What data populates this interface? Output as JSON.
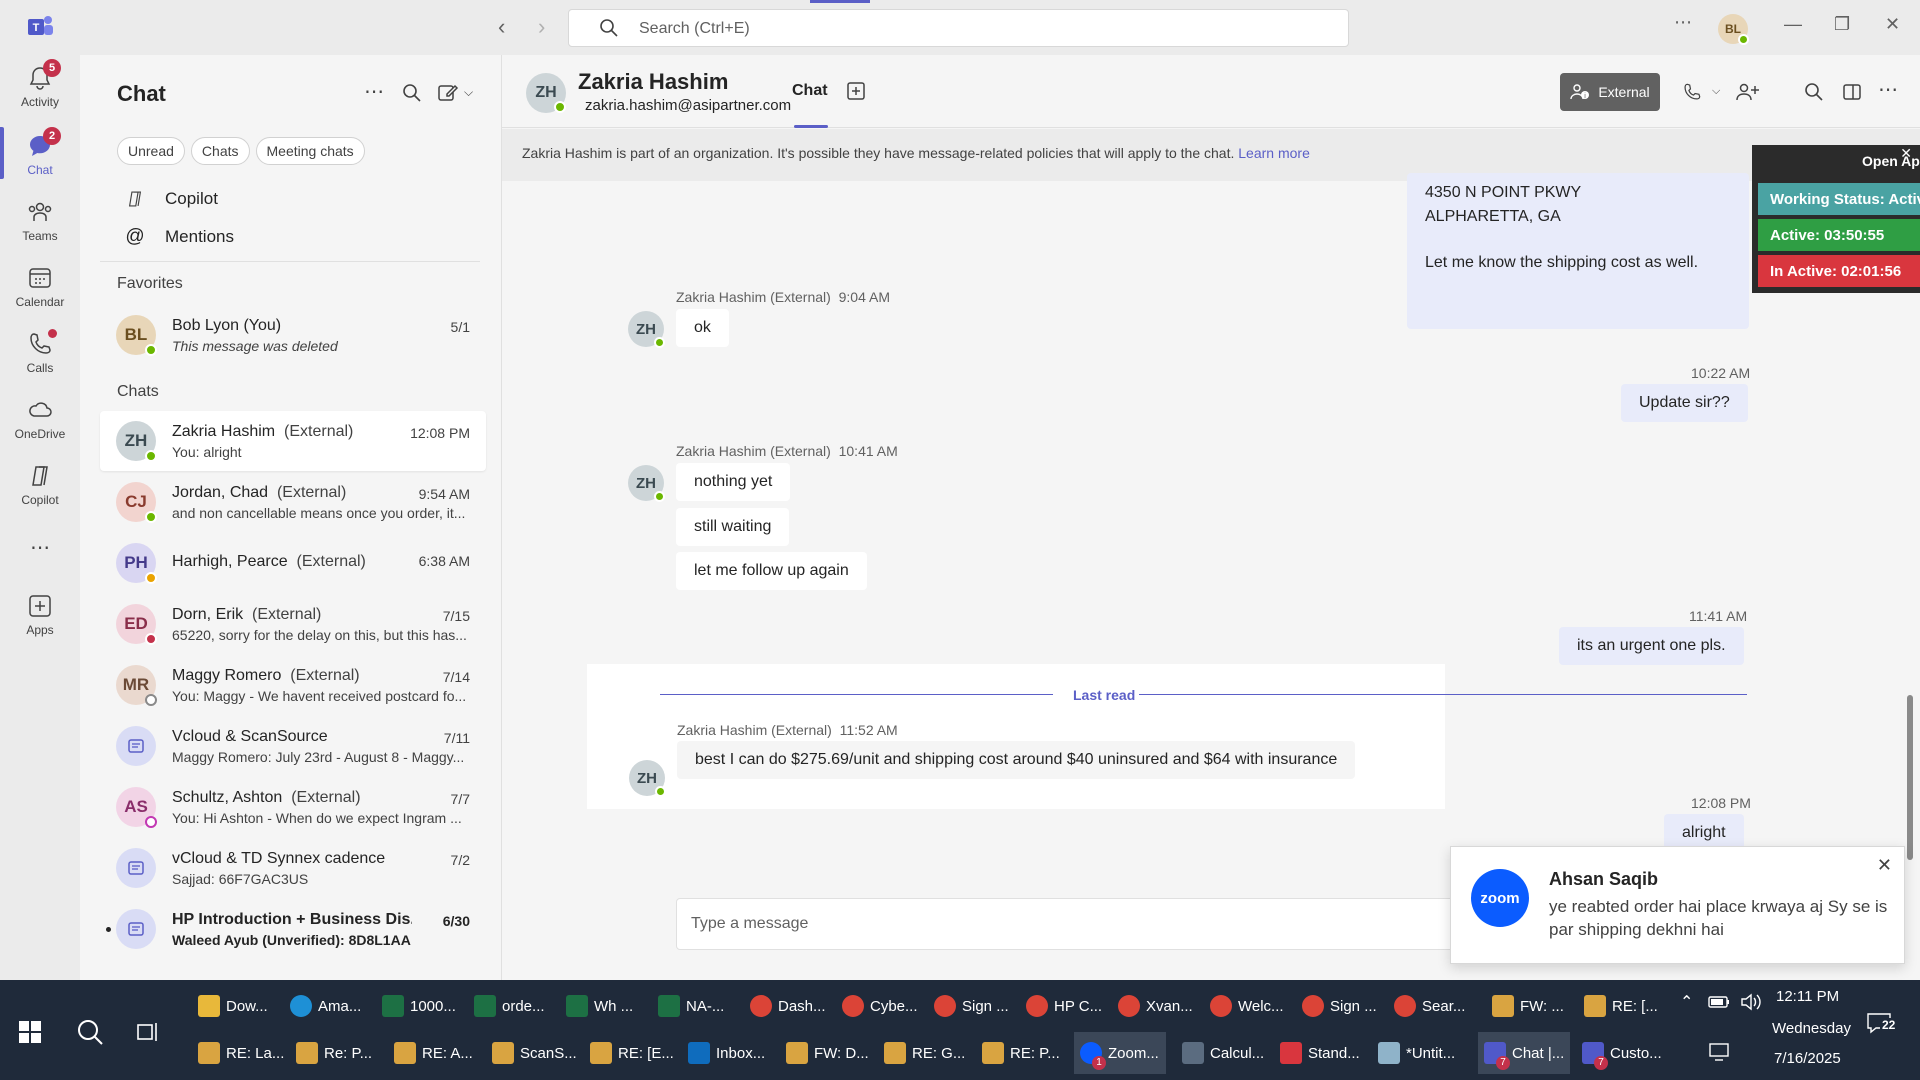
{
  "titlebar": {
    "search_placeholder": "Search (Ctrl+E)",
    "user_initials": "BL"
  },
  "rail": {
    "items": [
      {
        "label": "Activity",
        "badge": "5"
      },
      {
        "label": "Chat",
        "badge": "2"
      },
      {
        "label": "Teams"
      },
      {
        "label": "Calendar"
      },
      {
        "label": "Calls"
      },
      {
        "label": "OneDrive"
      },
      {
        "label": "Copilot"
      },
      {
        "label": "Apps"
      }
    ]
  },
  "chatlist": {
    "title": "Chat",
    "filters": [
      "Unread",
      "Chats",
      "Meeting chats"
    ],
    "links": [
      "Copilot",
      "Mentions"
    ],
    "favorites_label": "Favorites",
    "chats_label": "Chats",
    "favorites": [
      {
        "initials": "BL",
        "name": "Bob Lyon (You)",
        "preview": "This message was deleted",
        "time": "5/1"
      }
    ],
    "chats": [
      {
        "initials": "ZH",
        "name": "Zakria Hashim",
        "ext": "(External)",
        "preview": "You: alright",
        "time": "12:08 PM"
      },
      {
        "initials": "CJ",
        "name": "Jordan, Chad",
        "ext": "(External)",
        "preview": "and non cancellable means once you order, it...",
        "time": "9:54 AM"
      },
      {
        "initials": "PH",
        "name": "Harhigh, Pearce",
        "ext": "(External)",
        "preview": "",
        "time": "6:38 AM"
      },
      {
        "initials": "ED",
        "name": "Dorn, Erik",
        "ext": "(External)",
        "preview": "65220, sorry for the delay on this, but this has...",
        "time": "7/15"
      },
      {
        "initials": "MR",
        "name": "Maggy Romero",
        "ext": "(External)",
        "preview": "You: Maggy - We havent received postcard fo...",
        "time": "7/14"
      },
      {
        "initials": "",
        "name": "Vcloud & ScanSource",
        "ext": "",
        "preview": "Maggy Romero: July 23rd - August 8 - Maggy...",
        "time": "7/11"
      },
      {
        "initials": "AS",
        "name": "Schultz, Ashton",
        "ext": "(External)",
        "preview": "You: Hi Ashton -  When do we expect Ingram ...",
        "time": "7/7"
      },
      {
        "initials": "",
        "name": "vCloud & TD Synnex cadence",
        "ext": "",
        "preview": "Sajjad: 66F7GAC3US",
        "time": "7/2"
      },
      {
        "initials": "",
        "name": "HP Introduction + Business Dis...",
        "ext": "",
        "preview": "Waleed Ayub (Unverified): 8D8L1AA",
        "time": "6/30"
      }
    ]
  },
  "main": {
    "header": {
      "initials": "ZH",
      "name": "Zakria Hashim",
      "email": "zakria.hashim@asipartner.com",
      "tab": "Chat",
      "external_label": "External"
    },
    "banner": {
      "text": "Zakria Hashim is part of an organization. It's possible they have message-related policies that will apply to the chat.",
      "link": "Learn more"
    },
    "top_out_message": {
      "line1": "4350 N POINT PKWY",
      "line2": "ALPHARETTA, GA",
      "line3": "Let me know the shipping cost as well."
    },
    "messages": {
      "m1_meta": "Zakria Hashim (External)",
      "m1_time": "9:04 AM",
      "m1_text": "ok",
      "o1_time": "10:22 AM",
      "o1_text": "Update sir??",
      "m2_meta": "Zakria Hashim (External)",
      "m2_time": "10:41 AM",
      "m2_text1": "nothing yet",
      "m2_text2": "still waiting",
      "m2_text3": "let me follow up again",
      "o2_time": "11:41 AM",
      "o2_text": "its an urgent one pls.",
      "last_read": "Last read",
      "m3_meta": "Zakria Hashim (External)",
      "m3_time": "11:52 AM",
      "m3_text": "best I can do $275.69/unit and shipping cost around $40 uninsured and $64 with insurance",
      "o3_time": "12:08 PM",
      "o3_text": "alright"
    },
    "compose_placeholder": "Type a message"
  },
  "status_widget": {
    "open_label": "Open Ap",
    "working": "Working Status: Active",
    "active": "Active: 03:50:55",
    "inactive": "In Active: 02:01:56",
    "colors": {
      "working": "#4aa3a3",
      "active": "#2f9e44",
      "inactive": "#d9363e"
    }
  },
  "toast": {
    "app": "zoom",
    "title": "Ahsan Saqib",
    "body": "ye reabted order hai place krwaya aj Sy se is par shipping dekhni hai"
  },
  "taskbar": {
    "row1": [
      "Dow...",
      "Ama...",
      "1000...",
      "orde...",
      "Wh ...",
      "NA-...",
      "Dash...",
      "Cybe...",
      "Sign ...",
      "HP C...",
      "Xvan...",
      "Welc...",
      "Sign ...",
      "Sear...",
      "FW: ...",
      "RE: [..."
    ],
    "row2": [
      "RE: La...",
      "Re: P...",
      "RE: A...",
      "ScanS...",
      "RE: [E...",
      "Inbox...",
      "FW: D...",
      "RE: G...",
      "RE: P...",
      "Zoom...",
      "Calcul...",
      "Stand...",
      "*Untit...",
      "Chat |...",
      "Custo..."
    ],
    "zoom_badge": "1",
    "teams_badge": "7",
    "custo_badge": "7",
    "time": "12:11 PM",
    "day": "Wednesday",
    "date": "7/16/2025",
    "notif_count": "22"
  },
  "colors": {
    "accent": "#5b5fc7",
    "presence": "#6bb700"
  }
}
